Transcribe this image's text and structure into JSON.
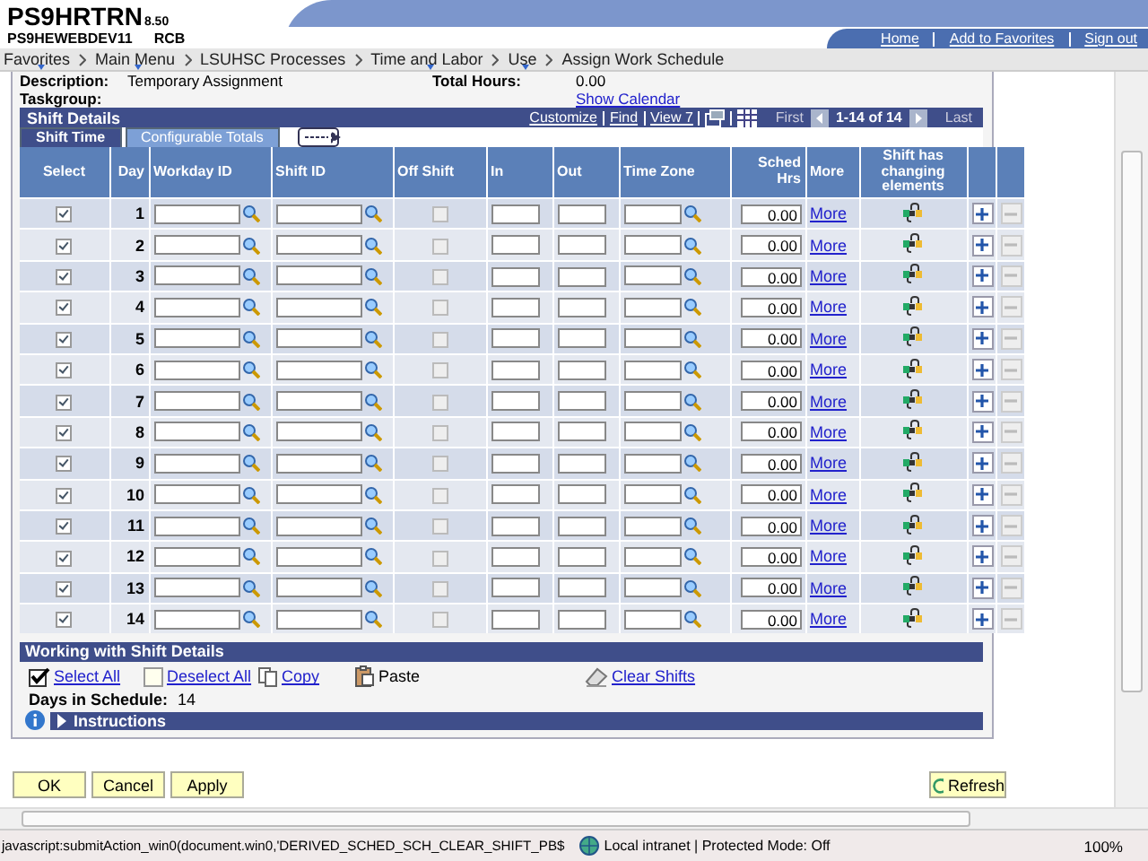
{
  "header": {
    "app_name": "PS9HRTRN",
    "version": "8.50",
    "server": "PS9HEWEBDEV11",
    "user": "RCB",
    "links": [
      "Home",
      "Add to Favorites",
      "Sign out"
    ]
  },
  "breadcrumbs": [
    {
      "label": "Favorites",
      "menu": true
    },
    {
      "label": "Main Menu",
      "menu": true
    },
    {
      "label": "LSUHSC Processes",
      "menu": false
    },
    {
      "label": "Time and Labor",
      "menu": true
    },
    {
      "label": "Use",
      "menu": true
    },
    {
      "label": "Assign Work Schedule",
      "menu": false
    }
  ],
  "summary": {
    "description_label": "Description:",
    "description": "Temporary Assignment",
    "total_hours_label": "Total Hours:",
    "total_hours": "0.00",
    "taskgroup_label": "Taskgroup:",
    "show_calendar": "Show Calendar"
  },
  "grid": {
    "title": "Shift Details",
    "nav_links": [
      "Customize",
      "Find",
      "View 7"
    ],
    "first": "First",
    "range": "1-14 of 14",
    "last": "Last",
    "tabs": [
      {
        "label": "Shift Time",
        "selected": true
      },
      {
        "label": "Configurable Totals",
        "selected": false
      }
    ],
    "columns": [
      "Select",
      "Day",
      "Workday ID",
      "Shift ID",
      "Off Shift",
      "In",
      "Out",
      "Time Zone",
      "Sched Hrs",
      "More",
      "Shift has changing elements"
    ],
    "rows": [
      {
        "select": true,
        "day": "1",
        "off_shift": false,
        "sched_hrs": "0.00",
        "more": "More"
      },
      {
        "select": true,
        "day": "2",
        "off_shift": false,
        "sched_hrs": "0.00",
        "more": "More"
      },
      {
        "select": true,
        "day": "3",
        "off_shift": false,
        "sched_hrs": "0.00",
        "more": "More"
      },
      {
        "select": true,
        "day": "4",
        "off_shift": false,
        "sched_hrs": "0.00",
        "more": "More"
      },
      {
        "select": true,
        "day": "5",
        "off_shift": false,
        "sched_hrs": "0.00",
        "more": "More"
      },
      {
        "select": true,
        "day": "6",
        "off_shift": false,
        "sched_hrs": "0.00",
        "more": "More"
      },
      {
        "select": true,
        "day": "7",
        "off_shift": false,
        "sched_hrs": "0.00",
        "more": "More"
      },
      {
        "select": true,
        "day": "8",
        "off_shift": false,
        "sched_hrs": "0.00",
        "more": "More"
      },
      {
        "select": true,
        "day": "9",
        "off_shift": false,
        "sched_hrs": "0.00",
        "more": "More"
      },
      {
        "select": true,
        "day": "10",
        "off_shift": false,
        "sched_hrs": "0.00",
        "more": "More"
      },
      {
        "select": true,
        "day": "11",
        "off_shift": false,
        "sched_hrs": "0.00",
        "more": "More"
      },
      {
        "select": true,
        "day": "12",
        "off_shift": false,
        "sched_hrs": "0.00",
        "more": "More"
      },
      {
        "select": true,
        "day": "13",
        "off_shift": false,
        "sched_hrs": "0.00",
        "more": "More"
      },
      {
        "select": true,
        "day": "14",
        "off_shift": false,
        "sched_hrs": "0.00",
        "more": "More"
      }
    ]
  },
  "working": {
    "title": "Working with Shift Details",
    "actions": [
      {
        "label": "Select All",
        "kind": "select",
        "link": true
      },
      {
        "label": "Deselect All",
        "kind": "deselect",
        "link": true
      },
      {
        "label": "Copy",
        "kind": "copy",
        "link": true
      },
      {
        "label": "Paste",
        "kind": "paste",
        "link": false
      },
      {
        "label": "Clear Shifts",
        "kind": "clear",
        "link": true
      }
    ],
    "days_label": "Days in Schedule:",
    "days": "14",
    "instructions": "Instructions",
    "instructions_expanded": false
  },
  "buttons": [
    "OK",
    "Cancel",
    "Apply"
  ],
  "refresh": "Refresh",
  "status_bar": {
    "text": "javascript:submitAction_win0(document.win0,'DERIVED_SCHED_SCH_CLEAR_SHIFT_PB$",
    "zone": "Local intranet | Protected Mode: Off",
    "zoom": "100%"
  }
}
